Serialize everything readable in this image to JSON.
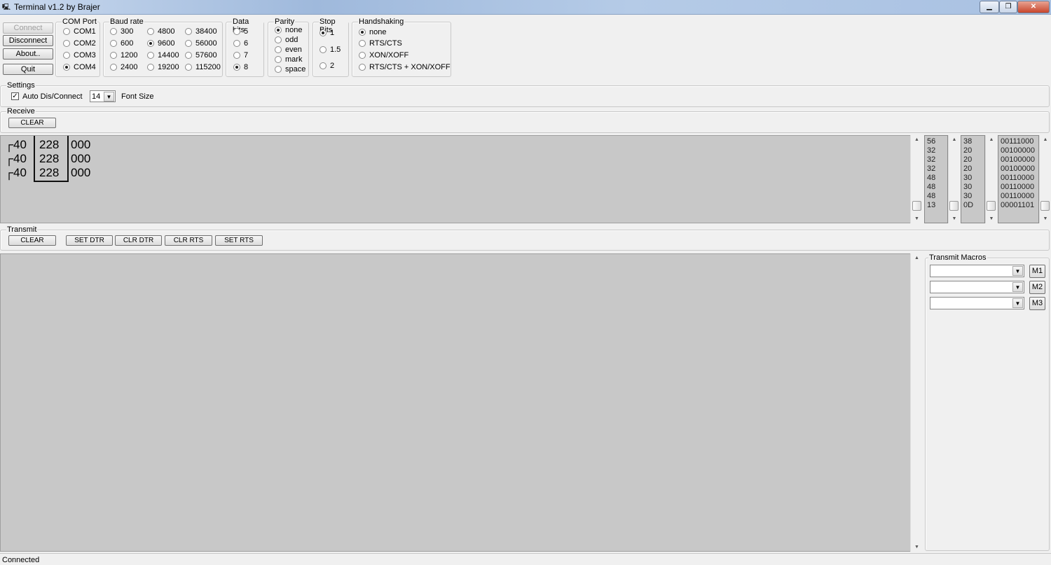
{
  "window": {
    "title": "Terminal v1.2 by Brajer",
    "app_icon": "terminal-app-icon",
    "controls": [
      "minimize",
      "maximize",
      "close"
    ]
  },
  "actions": {
    "connect": "Connect",
    "disconnect": "Disconnect",
    "about": "About..",
    "quit": "Quit"
  },
  "com_port": {
    "legend": "COM Port",
    "options": [
      "COM1",
      "COM2",
      "COM3",
      "COM4"
    ],
    "selected": "COM4"
  },
  "baud_rate": {
    "legend": "Baud rate",
    "options": [
      "300",
      "600",
      "1200",
      "2400",
      "4800",
      "9600",
      "14400",
      "19200",
      "38400",
      "56000",
      "57600",
      "115200"
    ],
    "selected": "9600"
  },
  "data_bits": {
    "legend": "Data bits",
    "options": [
      "5",
      "6",
      "7",
      "8"
    ],
    "selected": "8"
  },
  "parity": {
    "legend": "Parity",
    "options": [
      "none",
      "odd",
      "even",
      "mark",
      "space"
    ],
    "selected": "none"
  },
  "stop_bits": {
    "legend": "Stop Bits",
    "options": [
      "1",
      "1.5",
      "2"
    ],
    "selected": "1"
  },
  "handshaking": {
    "legend": "Handshaking",
    "options": [
      "none",
      "RTS/CTS",
      "XON/XOFF",
      "RTS/CTS + XON/XOFF"
    ],
    "selected": "none"
  },
  "settings": {
    "legend": "Settings",
    "auto_label": "Auto Dis/Connect",
    "auto_checked": true,
    "font_size": "14",
    "font_size_label": "Font Size"
  },
  "receive": {
    "legend": "Receive",
    "clear": "CLEAR",
    "lines": [
      "┌40",
      "┌40",
      "┌40"
    ],
    "lines_mid": [
      "228",
      "228",
      "228"
    ],
    "lines_end": [
      "000",
      "000",
      "000"
    ],
    "dec": [
      "56",
      "32",
      "32",
      "32",
      "48",
      "48",
      "48",
      "13"
    ],
    "hex": [
      "38",
      "20",
      "20",
      "20",
      "30",
      "30",
      "30",
      "0D"
    ],
    "bin": [
      "00111000",
      "00100000",
      "00100000",
      "00100000",
      "00110000",
      "00110000",
      "00110000",
      "00001101"
    ]
  },
  "transmit": {
    "legend": "Transmit",
    "buttons": [
      "CLEAR",
      "SET DTR",
      "CLR DTR",
      "CLR RTS",
      "SET RTS"
    ]
  },
  "macros": {
    "legend": "Transmit Macros",
    "items": [
      {
        "value": "",
        "button": "M1"
      },
      {
        "value": "",
        "button": "M2"
      },
      {
        "value": "",
        "button": "M3"
      }
    ]
  },
  "status": {
    "text": "Connected"
  }
}
